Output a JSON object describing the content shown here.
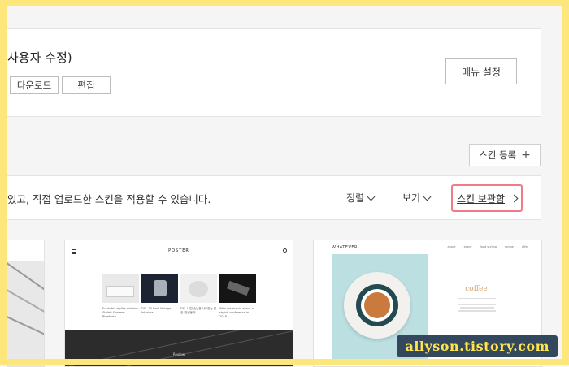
{
  "skin": {
    "title_fragment": "사용자 수정)",
    "buttons": {
      "download": "다운로드",
      "edit": "편집"
    },
    "menu_settings": "메뉴 설정"
  },
  "register_button": {
    "label": "스킨 등록",
    "icon": "plus-icon"
  },
  "info_bar": {
    "text": "있고, 직접 업로드한 스킨을 적용할 수 있습니다.",
    "sort_label": "정렬",
    "view_label": "보기",
    "storage_label": "스킨 보관함"
  },
  "thumbnails": [
    {
      "brand": ""
    },
    {
      "brand": "POSTER",
      "captions": [
        "Euphobia stylish outdoor: Stylish Summer Bluetooth",
        "DS - 13 Best Vintage Interiors",
        "DS - 내일 손님을 사로잡는 물건 '강남동자'",
        "Who are should about a stylish conference in 2018"
      ],
      "hero_label": "Review"
    },
    {
      "brand": "WHATEVER",
      "nav": [
        "about",
        "event",
        "food styling",
        "recipe",
        "offer"
      ],
      "feature_label": "coffee"
    }
  ],
  "watermark": "allyson.tistory.com",
  "colors": {
    "frame": "#fde77a",
    "highlight": "#f07a86",
    "watermark_bg": "#33485c",
    "watermark_text": "#ffe44d"
  }
}
